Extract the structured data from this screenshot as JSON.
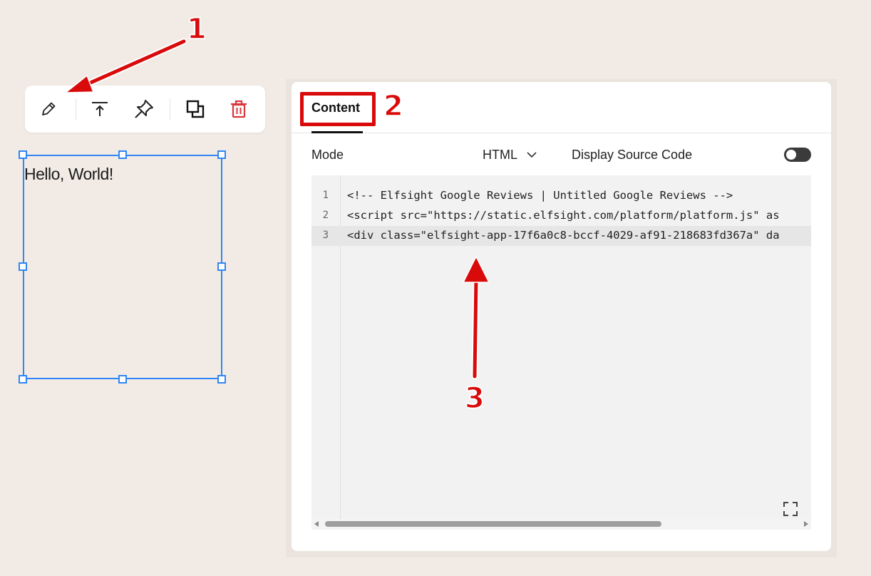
{
  "toolbar": {
    "buttons": [
      {
        "name": "edit-pencil-icon"
      },
      {
        "name": "move-to-top-icon"
      },
      {
        "name": "pin-icon"
      },
      {
        "name": "duplicate-icon"
      },
      {
        "name": "trash-icon"
      }
    ],
    "trash_color": "#d9363e"
  },
  "block": {
    "text": "Hello, World!",
    "selection_color": "#2f86f6"
  },
  "panel": {
    "tab_label": "Content",
    "mode_label": "Mode",
    "mode_value": "HTML",
    "source_label": "Display Source Code",
    "source_toggle_on": false
  },
  "editor": {
    "lines": [
      {
        "num": "1",
        "code": "<!-- Elfsight Google Reviews | Untitled Google Reviews -->"
      },
      {
        "num": "2",
        "code": "<script src=\"https://static.elfsight.com/platform/platform.js\" as"
      },
      {
        "num": "3",
        "code": "<div class=\"elfsight-app-17f6a0c8-bccf-4029-af91-218683fd367a\" da"
      }
    ],
    "active_line": "3"
  },
  "annotations": {
    "one": "1",
    "two": "2",
    "three": "3",
    "color": "#d90a0a"
  }
}
